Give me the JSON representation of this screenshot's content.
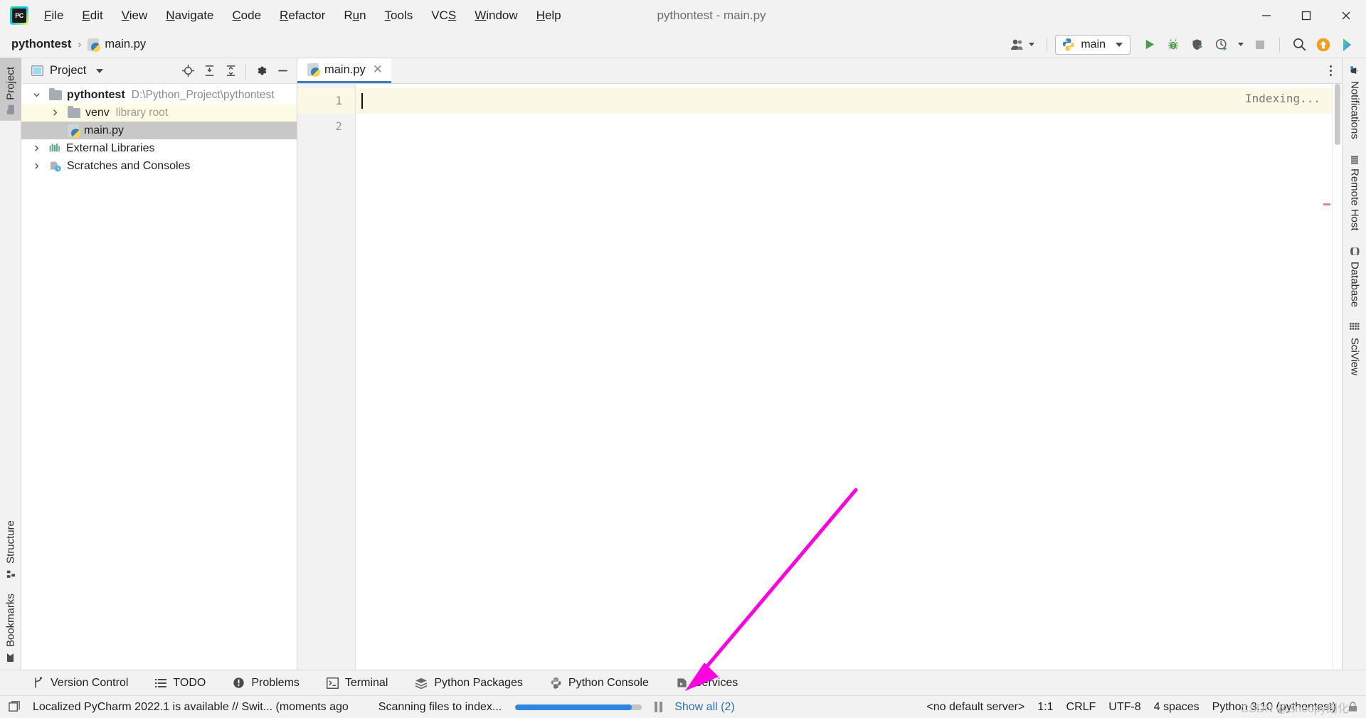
{
  "window": {
    "title": "pythontest - main.py",
    "logo_icon": "pycharm-logo-icon",
    "minimize_label": "Minimize",
    "maximize_label": "Maximize",
    "close_label": "Close"
  },
  "menubar": {
    "items": [
      {
        "label": "File",
        "mnemonic": "F"
      },
      {
        "label": "Edit",
        "mnemonic": "E"
      },
      {
        "label": "View",
        "mnemonic": "V"
      },
      {
        "label": "Navigate",
        "mnemonic": "N"
      },
      {
        "label": "Code",
        "mnemonic": "C"
      },
      {
        "label": "Refactor",
        "mnemonic": "R"
      },
      {
        "label": "Run",
        "mnemonic": "u"
      },
      {
        "label": "Tools",
        "mnemonic": "T"
      },
      {
        "label": "VCS",
        "mnemonic": "S"
      },
      {
        "label": "Window",
        "mnemonic": "W"
      },
      {
        "label": "Help",
        "mnemonic": "H"
      }
    ]
  },
  "navbar": {
    "breadcrumbs": [
      {
        "label": "pythontest",
        "icon": "",
        "bold": true
      },
      {
        "label": "main.py",
        "icon": "python-file-icon",
        "bold": false
      }
    ],
    "separator": "›",
    "run_config": {
      "label": "main",
      "icon": "python-icon",
      "dropdown_icon": "chevron-down-icon"
    },
    "buttons": [
      {
        "name": "collaborate-icon",
        "label": "Code With Me"
      },
      {
        "name": "run-icon",
        "label": "Run 'main'"
      },
      {
        "name": "debug-icon",
        "label": "Debug 'main'"
      },
      {
        "name": "run-coverage-icon",
        "label": "Run with Coverage"
      },
      {
        "name": "profile-icon",
        "label": "Profile 'main'"
      },
      {
        "name": "stop-icon",
        "label": "Stop"
      },
      {
        "name": "search-everywhere-icon",
        "label": "Search Everywhere"
      },
      {
        "name": "update-project-icon",
        "label": "Update Project"
      },
      {
        "name": "ide-features-trainer-icon",
        "label": "Learn IDE Features"
      }
    ]
  },
  "left_stripe": {
    "tabs": [
      {
        "label": "Project",
        "icon": "project-icon",
        "active": true
      },
      {
        "label": "Structure",
        "icon": "structure-icon",
        "active": false
      },
      {
        "label": "Bookmarks",
        "icon": "bookmarks-icon",
        "active": false
      }
    ]
  },
  "right_stripe": {
    "tabs": [
      {
        "label": "Notifications",
        "icon": "bell-icon"
      },
      {
        "label": "Remote Host",
        "icon": "remote-host-icon"
      },
      {
        "label": "Database",
        "icon": "database-icon"
      },
      {
        "label": "SciView",
        "icon": "sciview-icon"
      }
    ]
  },
  "project_panel": {
    "title": "Project",
    "title_icon": "project-icon",
    "dropdown_icon": "chevron-down-icon",
    "toolbar": [
      {
        "name": "select-opened-file-icon",
        "label": "Select Opened File"
      },
      {
        "name": "expand-all-icon",
        "label": "Expand All"
      },
      {
        "name": "collapse-all-icon",
        "label": "Collapse All"
      },
      {
        "name": "settings-gear-icon",
        "label": "Options"
      },
      {
        "name": "hide-panel-icon",
        "label": "Hide"
      }
    ],
    "tree": [
      {
        "label": "pythontest",
        "detail": "D:\\Python_Project\\pythontest",
        "icon": "folder-icon",
        "arrow": "chevron-down-icon",
        "depth": 0,
        "bold": true,
        "highlight": "none"
      },
      {
        "label": "venv",
        "detail": "library root",
        "icon": "folder-icon",
        "arrow": "chevron-right-icon",
        "depth": 1,
        "bold": false,
        "highlight": "yellow"
      },
      {
        "label": "main.py",
        "detail": "",
        "icon": "python-file-icon",
        "arrow": "",
        "depth": 2,
        "bold": false,
        "highlight": "selected"
      },
      {
        "label": "External Libraries",
        "detail": "",
        "icon": "external-libraries-icon",
        "arrow": "chevron-right-icon",
        "depth": 0,
        "bold": false,
        "highlight": "none"
      },
      {
        "label": "Scratches and Consoles",
        "detail": "",
        "icon": "scratches-icon",
        "arrow": "chevron-right-icon",
        "depth": 0,
        "bold": false,
        "highlight": "none"
      }
    ]
  },
  "editor": {
    "tabs": [
      {
        "label": "main.py",
        "icon": "python-file-icon",
        "close_icon": "close-icon",
        "active": true
      }
    ],
    "options_icon": "more-options-icon",
    "line_numbers": [
      "1",
      "2"
    ],
    "lines": [
      "",
      ""
    ],
    "current_line": 1,
    "indexing_status": "Indexing..."
  },
  "bottom_bar": {
    "tabs": [
      {
        "label": "Version Control",
        "icon": "branch-icon"
      },
      {
        "label": "TODO",
        "icon": "todo-list-icon"
      },
      {
        "label": "Problems",
        "icon": "problems-icon"
      },
      {
        "label": "Terminal",
        "icon": "terminal-icon"
      },
      {
        "label": "Python Packages",
        "icon": "packages-icon"
      },
      {
        "label": "Python Console",
        "icon": "python-icon"
      },
      {
        "label": "Services",
        "icon": "services-icon"
      }
    ]
  },
  "status_bar": {
    "notification_icon": "ide-message-icon",
    "notification": "Localized PyCharm 2022.1 is available // Swit... (moments ago",
    "progress_text": "Scanning files to index...",
    "progress_percent": 92,
    "pause_icon": "pause-icon",
    "show_all": "Show all (2)",
    "server": "<no default server>",
    "caret_position": "1:1",
    "line_separator": "CRLF",
    "encoding": "UTF-8",
    "indent": "4 spaces",
    "interpreter": "Python 3.10 (pythontest)",
    "lock_icon": "lock-icon"
  },
  "annotation": {
    "arrow_color": "#ff00e0",
    "points_to": "Services"
  },
  "watermark": "CSDN @Snoopy朗化",
  "colors": {
    "accent_blue": "#2f84e0",
    "tab_underline": "#3d7ebf",
    "highlight_yellow": "#fcfbe3",
    "selection_gray": "#c8c8c8",
    "run_green": "#4a9c4a"
  }
}
